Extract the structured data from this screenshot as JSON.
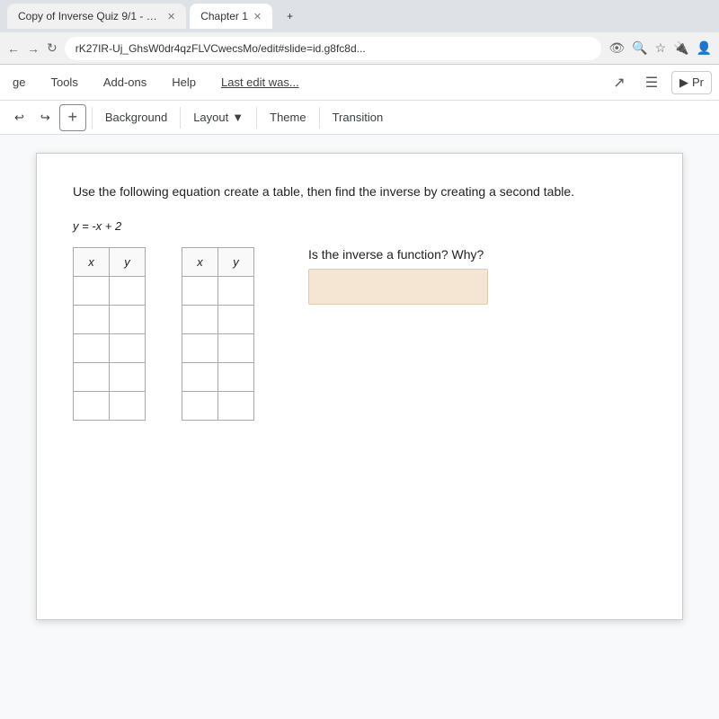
{
  "browser": {
    "tab1": {
      "label": "Copy of Inverse Quiz 9/1 - Goog",
      "active": false
    },
    "tab2": {
      "label": "Chapter 1",
      "active": true
    },
    "address": "rK27IR-Uj_GhsW0dr4qzFLVCwecsMo/edit#slide=id.g8fc8d...",
    "icons": {
      "eye": "👁",
      "search": "🔍",
      "star": "☆",
      "settings": "⚙"
    }
  },
  "menubar": {
    "items": [
      "ge",
      "Tools",
      "Add-ons",
      "Help"
    ],
    "last_edit": "Last edit was...",
    "icons": {
      "trend": "↗",
      "comment": "💬",
      "present": "▶",
      "present_label": "Pr"
    }
  },
  "toolbar": {
    "add_button": "+",
    "background": "Background",
    "layout": "Layout",
    "layout_arrow": "▼",
    "theme": "Theme",
    "transition": "Transition"
  },
  "slide": {
    "instruction": "Use the following equation create a table, then find the inverse by creating a second table.",
    "equation": "y = -x + 2",
    "inverse_question": "Is the inverse a function? Why?",
    "table1": {
      "headers": [
        "x",
        "y"
      ],
      "rows": [
        [
          "",
          ""
        ],
        [
          "",
          ""
        ],
        [
          "",
          ""
        ],
        [
          "",
          ""
        ],
        [
          "",
          ""
        ]
      ]
    },
    "table2": {
      "headers": [
        "x",
        "y"
      ],
      "rows": [
        [
          "",
          ""
        ],
        [
          "",
          ""
        ],
        [
          "",
          ""
        ],
        [
          "",
          ""
        ],
        [
          "",
          ""
        ]
      ]
    }
  }
}
